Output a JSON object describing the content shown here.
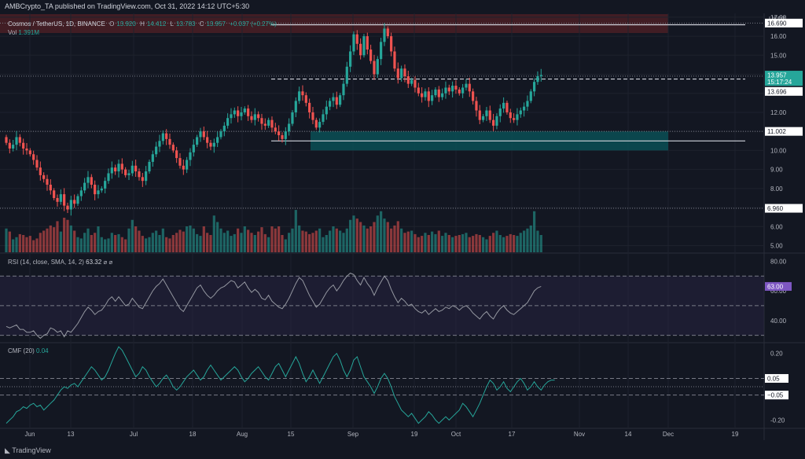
{
  "header": {
    "text": "AMBCrypto_TA published on TradingView.com, Oct 31, 2022 14:12 UTC+5:30"
  },
  "legend": {
    "symbol": "Cosmos / TetherUS, 1D, BINANCE",
    "o_label": "O",
    "o": "13.920",
    "h_label": "H",
    "h": "14.412",
    "l_label": "L",
    "l": "13.783",
    "c_label": "C",
    "c": "13.957",
    "chg": "+0.037 (+0.27%)",
    "vol_label": "Vol",
    "vol": "1.391M"
  },
  "rsi_legend": {
    "label": "RSI (14, close, SMA, 14, 2)",
    "value": "63.32",
    "extra": "⌀ ⌀"
  },
  "cmf_legend": {
    "label": "CMF (20)",
    "value": "0.04"
  },
  "footer": {
    "text": "TradingView"
  },
  "currency": "USDT",
  "colors": {
    "bg": "#131722",
    "up": "#26a69a",
    "down": "#ef5350",
    "grid": "#1e222d",
    "text": "#b2b5be",
    "zone": "#0b4f55",
    "rsi_line": "#9598a1",
    "cmf_line": "#26a69a",
    "rsi_band": "#2a2646",
    "header_band": "#4a1f25"
  },
  "chart_data": [
    {
      "type": "candlestick",
      "name": "price",
      "yticks": [
        5,
        6,
        7,
        8,
        9,
        10,
        11,
        12,
        13,
        14,
        15,
        16,
        17
      ],
      "ylim": [
        4.65,
        17.2
      ],
      "x_tick_labels": [
        "Jun",
        "13",
        "Jul",
        "18",
        "Aug",
        "15",
        "Sep",
        "19",
        "Oct",
        "17",
        "Nov",
        "14",
        "Dec",
        "19"
      ],
      "price_labels": [
        {
          "value": "16.690",
          "price": 16.69,
          "style": "white"
        },
        {
          "value": "13.957",
          "price": 13.957,
          "style": "teal"
        },
        {
          "value": "15:17:24",
          "price": 13.6,
          "style": "teal-small"
        },
        {
          "value": "13.696",
          "price": 13.1,
          "style": "white"
        },
        {
          "value": "11.002",
          "price": 11.0,
          "style": "white"
        },
        {
          "value": "6.960",
          "price": 6.96,
          "style": "white"
        }
      ],
      "levels": [
        16.69,
        14.0,
        11.0,
        6.96
      ],
      "support_zone": [
        10.0,
        11.0
      ],
      "closes": [
        10.4,
        10.1,
        10.3,
        10.7,
        10.4,
        10.1,
        10.0,
        9.8,
        9.5,
        9.1,
        8.7,
        8.5,
        8.2,
        7.9,
        7.5,
        7.3,
        7.7,
        7.1,
        6.9,
        7.4,
        7.2,
        7.6,
        7.9,
        8.3,
        8.6,
        8.2,
        7.7,
        7.9,
        8.0,
        8.4,
        8.8,
        9.1,
        8.9,
        9.3,
        9.0,
        8.7,
        8.8,
        9.2,
        8.9,
        8.6,
        8.4,
        8.9,
        9.4,
        9.8,
        10.2,
        10.5,
        10.9,
        10.6,
        10.3,
        10.0,
        9.6,
        9.2,
        9.0,
        9.5,
        9.9,
        10.3,
        10.7,
        11.0,
        10.7,
        10.4,
        10.2,
        10.4,
        10.7,
        11.0,
        11.3,
        11.7,
        11.9,
        12.1,
        11.8,
        12.0,
        12.2,
        11.8,
        11.6,
        11.9,
        11.7,
        11.4,
        11.3,
        11.6,
        11.2,
        11.0,
        10.8,
        10.6,
        11.0,
        11.4,
        12.0,
        12.6,
        13.1,
        12.9,
        12.5,
        12.0,
        11.6,
        11.2,
        11.5,
        11.9,
        12.3,
        12.6,
        12.8,
        12.4,
        12.9,
        13.5,
        14.4,
        15.2,
        16.1,
        15.6,
        15.0,
        16.0,
        15.3,
        14.7,
        14.0,
        14.8,
        15.7,
        16.4,
        16.0,
        15.2,
        14.3,
        13.8,
        14.3,
        13.9,
        13.5,
        13.7,
        13.3,
        13.0,
        12.8,
        13.1,
        12.6,
        12.9,
        13.2,
        12.8,
        13.0,
        13.3,
        13.1,
        13.4,
        13.2,
        13.0,
        13.3,
        13.5,
        13.1,
        12.6,
        12.1,
        11.6,
        11.8,
        12.1,
        11.6,
        11.3,
        11.8,
        12.2,
        12.5,
        12.0,
        11.7,
        11.6,
        11.9,
        12.1,
        12.3,
        12.6,
        13.1,
        13.6,
        13.9,
        13.96
      ]
    },
    {
      "type": "bar",
      "name": "volume",
      "bars": 163,
      "max_height_fraction": 1.0,
      "volume_relative": [
        0.55,
        0.48,
        0.3,
        0.35,
        0.42,
        0.4,
        0.35,
        0.38,
        0.28,
        0.32,
        0.45,
        0.5,
        0.55,
        0.62,
        0.58,
        0.72,
        0.48,
        0.8,
        0.75,
        0.62,
        0.5,
        0.35,
        0.32,
        0.45,
        0.55,
        0.4,
        0.45,
        0.6,
        0.35,
        0.3,
        0.32,
        0.45,
        0.4,
        0.42,
        0.35,
        0.3,
        0.55,
        0.75,
        0.6,
        0.5,
        0.38,
        0.32,
        0.35,
        0.45,
        0.5,
        0.4,
        0.55,
        0.35,
        0.32,
        0.4,
        0.45,
        0.52,
        0.48,
        0.6,
        0.62,
        0.55,
        0.42,
        0.38,
        0.6,
        0.45,
        0.4,
        0.85,
        0.7,
        0.55,
        0.45,
        0.5,
        0.38,
        0.42,
        0.55,
        0.45,
        0.6,
        0.52,
        0.45,
        0.4,
        0.48,
        0.58,
        0.42,
        0.35,
        0.6,
        0.55,
        0.6,
        0.4,
        0.3,
        0.45,
        0.55,
        0.98,
        0.62,
        0.5,
        0.48,
        0.42,
        0.45,
        0.5,
        0.55,
        0.35,
        0.4,
        0.5,
        0.6,
        0.55,
        0.5,
        0.45,
        0.55,
        0.75,
        0.85,
        0.78,
        0.7,
        0.62,
        0.55,
        0.6,
        0.7,
        0.85,
        0.95,
        0.78,
        0.7,
        0.55,
        0.62,
        0.72,
        0.55,
        0.45,
        0.48,
        0.5,
        0.42,
        0.35,
        0.38,
        0.45,
        0.4,
        0.48,
        0.42,
        0.5,
        0.38,
        0.45,
        0.4,
        0.35,
        0.38,
        0.4,
        0.42,
        0.45,
        0.35,
        0.38,
        0.42,
        0.4,
        0.35,
        0.3,
        0.38,
        0.45,
        0.5,
        0.4,
        0.35,
        0.38,
        0.42,
        0.4,
        0.38,
        0.45,
        0.5,
        0.55,
        0.62,
        0.95,
        0.5,
        0.4,
        0.2
      ]
    },
    {
      "type": "line",
      "name": "RSI",
      "yticks": [
        40,
        60,
        80
      ],
      "ylim": [
        25,
        85
      ],
      "bands": [
        30,
        50,
        70
      ],
      "values": [
        36,
        35,
        36,
        37,
        34,
        34,
        32,
        32,
        33,
        30,
        28,
        30,
        31,
        35,
        34,
        32,
        33,
        29,
        33,
        32,
        35,
        38,
        42,
        46,
        49,
        47,
        44,
        46,
        47,
        50,
        54,
        56,
        53,
        56,
        53,
        50,
        51,
        55,
        52,
        49,
        48,
        52,
        56,
        60,
        63,
        65,
        68,
        64,
        60,
        56,
        52,
        48,
        46,
        50,
        54,
        58,
        62,
        64,
        60,
        57,
        55,
        57,
        60,
        62,
        63,
        65,
        67,
        66,
        62,
        64,
        66,
        62,
        59,
        61,
        59,
        55,
        54,
        57,
        53,
        51,
        49,
        48,
        51,
        55,
        60,
        65,
        69,
        67,
        62,
        57,
        53,
        49,
        51,
        55,
        59,
        62,
        64,
        60,
        63,
        67,
        70,
        72,
        71,
        67,
        64,
        69,
        65,
        62,
        57,
        62,
        66,
        70,
        67,
        61,
        56,
        52,
        55,
        53,
        50,
        51,
        48,
        46,
        45,
        47,
        44,
        46,
        48,
        46,
        47,
        49,
        48,
        50,
        49,
        47,
        49,
        50,
        48,
        45,
        43,
        41,
        44,
        46,
        43,
        41,
        45,
        48,
        50,
        47,
        45,
        44,
        46,
        48,
        50,
        52,
        56,
        60,
        62,
        63
      ]
    },
    {
      "type": "line",
      "name": "CMF",
      "yticks": [
        -0.2,
        0.2
      ],
      "ylim": [
        -0.25,
        0.26
      ],
      "bands": [
        0.05,
        -0.05
      ],
      "values": [
        -0.22,
        -0.2,
        -0.18,
        -0.15,
        -0.14,
        -0.12,
        -0.13,
        -0.11,
        -0.1,
        -0.12,
        -0.11,
        -0.14,
        -0.12,
        -0.1,
        -0.08,
        -0.05,
        -0.02,
        0.0,
        -0.01,
        0.01,
        0.02,
        0.0,
        0.03,
        0.06,
        0.09,
        0.12,
        0.1,
        0.07,
        0.04,
        0.06,
        0.1,
        0.15,
        0.2,
        0.24,
        0.22,
        0.18,
        0.14,
        0.1,
        0.06,
        0.08,
        0.12,
        0.1,
        0.06,
        0.03,
        0.0,
        0.02,
        0.05,
        0.07,
        0.04,
        0.0,
        -0.02,
        0.0,
        0.03,
        0.06,
        0.08,
        0.1,
        0.07,
        0.04,
        0.06,
        0.1,
        0.13,
        0.1,
        0.07,
        0.04,
        0.06,
        0.08,
        0.1,
        0.12,
        0.1,
        0.06,
        0.03,
        0.05,
        0.08,
        0.1,
        0.12,
        0.09,
        0.06,
        0.04,
        0.08,
        0.12,
        0.14,
        0.1,
        0.06,
        0.1,
        0.14,
        0.18,
        0.14,
        0.08,
        0.03,
        0.06,
        0.1,
        0.06,
        0.02,
        0.06,
        0.1,
        0.14,
        0.18,
        0.2,
        0.16,
        0.1,
        0.06,
        0.1,
        0.16,
        0.18,
        0.12,
        0.06,
        0.03,
        0.0,
        -0.04,
        0.0,
        0.05,
        0.08,
        0.05,
        0.0,
        -0.06,
        -0.1,
        -0.14,
        -0.16,
        -0.18,
        -0.16,
        -0.19,
        -0.22,
        -0.2,
        -0.18,
        -0.15,
        -0.17,
        -0.2,
        -0.22,
        -0.2,
        -0.18,
        -0.2,
        -0.18,
        -0.16,
        -0.14,
        -0.1,
        -0.12,
        -0.15,
        -0.18,
        -0.14,
        -0.1,
        -0.05,
        0.0,
        0.04,
        0.02,
        -0.02,
        0.0,
        0.03,
        -0.01,
        -0.03,
        0.0,
        0.03,
        0.05,
        0.02,
        -0.02,
        0.0,
        0.03,
        0.0,
        -0.02,
        0.01,
        0.03,
        0.04,
        0.04
      ]
    }
  ]
}
